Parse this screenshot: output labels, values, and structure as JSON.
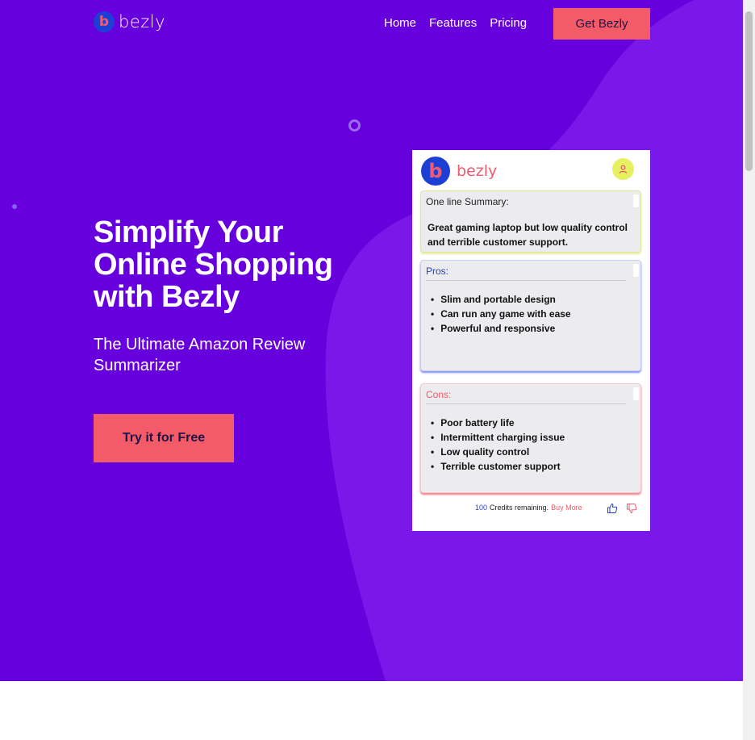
{
  "brand": {
    "name": "bezly",
    "mark": "b"
  },
  "nav": {
    "home": "Home",
    "features": "Features",
    "pricing": "Pricing"
  },
  "header": {
    "cta": "Get Bezly"
  },
  "hero": {
    "headline": "Simplify Your Online Shopping with Bezly",
    "subline": "The Ultimate Amazon Review Summarizer",
    "cta": "Try it for Free"
  },
  "preview": {
    "brand": "bezly",
    "summary": {
      "title": "One line Summary:",
      "text": "Great gaming laptop but low quality control and terrible customer support."
    },
    "pros": {
      "title": "Pros:",
      "items": [
        "Slim and portable design",
        "Can run any game with ease",
        "Powerful and responsive"
      ]
    },
    "cons": {
      "title": "Cons:",
      "items": [
        "Poor battery life",
        "Intermittent charging issue",
        "Low quality control",
        "Terrible customer support"
      ]
    },
    "footer": {
      "credits": "100",
      "credits_label": "Credits remaining.",
      "buy_more": "Buy More"
    }
  },
  "colors": {
    "hero_bg": "#6600dd",
    "hero_shape": "#7a18ea",
    "accent": "#f45b69",
    "brand_blue": "#1e3fd6"
  }
}
